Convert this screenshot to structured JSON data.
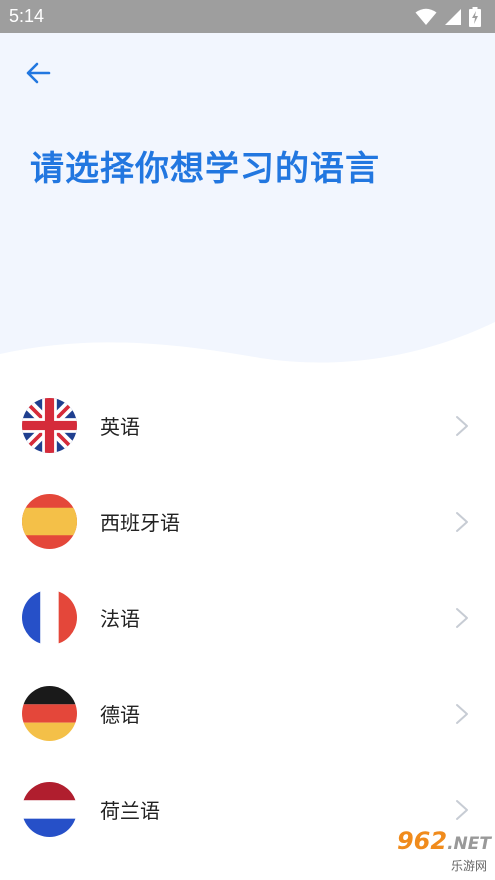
{
  "status_bar": {
    "time": "5:14",
    "icons": [
      "wifi-icon",
      "signal-icon",
      "battery-charging-icon"
    ]
  },
  "header": {
    "back_icon": "arrow-left-icon",
    "title": "请选择你想学习的语言"
  },
  "languages": [
    {
      "label": "英语",
      "flag": "uk-flag-icon"
    },
    {
      "label": "西班牙语",
      "flag": "spain-flag-icon"
    },
    {
      "label": "法语",
      "flag": "france-flag-icon"
    },
    {
      "label": "德语",
      "flag": "germany-flag-icon"
    },
    {
      "label": "荷兰语",
      "flag": "netherlands-flag-icon"
    }
  ],
  "watermark": {
    "top": "962",
    "top_suffix": ".NET",
    "bottom": "乐游网"
  },
  "colors": {
    "accent": "#2277e0",
    "header_bg": "#f2f6fe",
    "status_bar": "#9e9e9e"
  }
}
